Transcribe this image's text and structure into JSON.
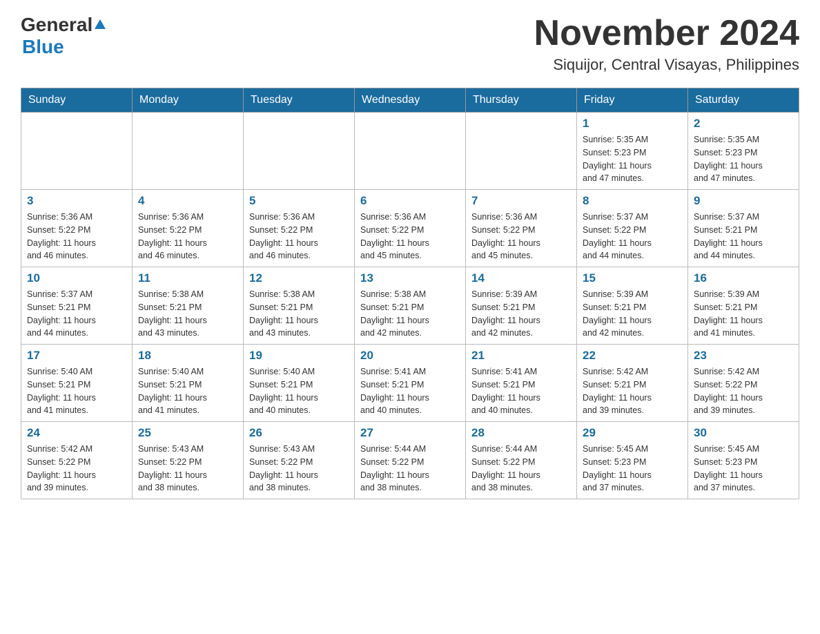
{
  "header": {
    "logo": {
      "general": "General",
      "blue": "Blue",
      "tagline": ""
    },
    "title": "November 2024",
    "subtitle": "Siquijor, Central Visayas, Philippines"
  },
  "calendar": {
    "headers": [
      "Sunday",
      "Monday",
      "Tuesday",
      "Wednesday",
      "Thursday",
      "Friday",
      "Saturday"
    ],
    "weeks": [
      [
        {
          "day": "",
          "info": ""
        },
        {
          "day": "",
          "info": ""
        },
        {
          "day": "",
          "info": ""
        },
        {
          "day": "",
          "info": ""
        },
        {
          "day": "",
          "info": ""
        },
        {
          "day": "1",
          "info": "Sunrise: 5:35 AM\nSunset: 5:23 PM\nDaylight: 11 hours\nand 47 minutes."
        },
        {
          "day": "2",
          "info": "Sunrise: 5:35 AM\nSunset: 5:23 PM\nDaylight: 11 hours\nand 47 minutes."
        }
      ],
      [
        {
          "day": "3",
          "info": "Sunrise: 5:36 AM\nSunset: 5:22 PM\nDaylight: 11 hours\nand 46 minutes."
        },
        {
          "day": "4",
          "info": "Sunrise: 5:36 AM\nSunset: 5:22 PM\nDaylight: 11 hours\nand 46 minutes."
        },
        {
          "day": "5",
          "info": "Sunrise: 5:36 AM\nSunset: 5:22 PM\nDaylight: 11 hours\nand 46 minutes."
        },
        {
          "day": "6",
          "info": "Sunrise: 5:36 AM\nSunset: 5:22 PM\nDaylight: 11 hours\nand 45 minutes."
        },
        {
          "day": "7",
          "info": "Sunrise: 5:36 AM\nSunset: 5:22 PM\nDaylight: 11 hours\nand 45 minutes."
        },
        {
          "day": "8",
          "info": "Sunrise: 5:37 AM\nSunset: 5:22 PM\nDaylight: 11 hours\nand 44 minutes."
        },
        {
          "day": "9",
          "info": "Sunrise: 5:37 AM\nSunset: 5:21 PM\nDaylight: 11 hours\nand 44 minutes."
        }
      ],
      [
        {
          "day": "10",
          "info": "Sunrise: 5:37 AM\nSunset: 5:21 PM\nDaylight: 11 hours\nand 44 minutes."
        },
        {
          "day": "11",
          "info": "Sunrise: 5:38 AM\nSunset: 5:21 PM\nDaylight: 11 hours\nand 43 minutes."
        },
        {
          "day": "12",
          "info": "Sunrise: 5:38 AM\nSunset: 5:21 PM\nDaylight: 11 hours\nand 43 minutes."
        },
        {
          "day": "13",
          "info": "Sunrise: 5:38 AM\nSunset: 5:21 PM\nDaylight: 11 hours\nand 42 minutes."
        },
        {
          "day": "14",
          "info": "Sunrise: 5:39 AM\nSunset: 5:21 PM\nDaylight: 11 hours\nand 42 minutes."
        },
        {
          "day": "15",
          "info": "Sunrise: 5:39 AM\nSunset: 5:21 PM\nDaylight: 11 hours\nand 42 minutes."
        },
        {
          "day": "16",
          "info": "Sunrise: 5:39 AM\nSunset: 5:21 PM\nDaylight: 11 hours\nand 41 minutes."
        }
      ],
      [
        {
          "day": "17",
          "info": "Sunrise: 5:40 AM\nSunset: 5:21 PM\nDaylight: 11 hours\nand 41 minutes."
        },
        {
          "day": "18",
          "info": "Sunrise: 5:40 AM\nSunset: 5:21 PM\nDaylight: 11 hours\nand 41 minutes."
        },
        {
          "day": "19",
          "info": "Sunrise: 5:40 AM\nSunset: 5:21 PM\nDaylight: 11 hours\nand 40 minutes."
        },
        {
          "day": "20",
          "info": "Sunrise: 5:41 AM\nSunset: 5:21 PM\nDaylight: 11 hours\nand 40 minutes."
        },
        {
          "day": "21",
          "info": "Sunrise: 5:41 AM\nSunset: 5:21 PM\nDaylight: 11 hours\nand 40 minutes."
        },
        {
          "day": "22",
          "info": "Sunrise: 5:42 AM\nSunset: 5:21 PM\nDaylight: 11 hours\nand 39 minutes."
        },
        {
          "day": "23",
          "info": "Sunrise: 5:42 AM\nSunset: 5:22 PM\nDaylight: 11 hours\nand 39 minutes."
        }
      ],
      [
        {
          "day": "24",
          "info": "Sunrise: 5:42 AM\nSunset: 5:22 PM\nDaylight: 11 hours\nand 39 minutes."
        },
        {
          "day": "25",
          "info": "Sunrise: 5:43 AM\nSunset: 5:22 PM\nDaylight: 11 hours\nand 38 minutes."
        },
        {
          "day": "26",
          "info": "Sunrise: 5:43 AM\nSunset: 5:22 PM\nDaylight: 11 hours\nand 38 minutes."
        },
        {
          "day": "27",
          "info": "Sunrise: 5:44 AM\nSunset: 5:22 PM\nDaylight: 11 hours\nand 38 minutes."
        },
        {
          "day": "28",
          "info": "Sunrise: 5:44 AM\nSunset: 5:22 PM\nDaylight: 11 hours\nand 38 minutes."
        },
        {
          "day": "29",
          "info": "Sunrise: 5:45 AM\nSunset: 5:23 PM\nDaylight: 11 hours\nand 37 minutes."
        },
        {
          "day": "30",
          "info": "Sunrise: 5:45 AM\nSunset: 5:23 PM\nDaylight: 11 hours\nand 37 minutes."
        }
      ]
    ]
  }
}
